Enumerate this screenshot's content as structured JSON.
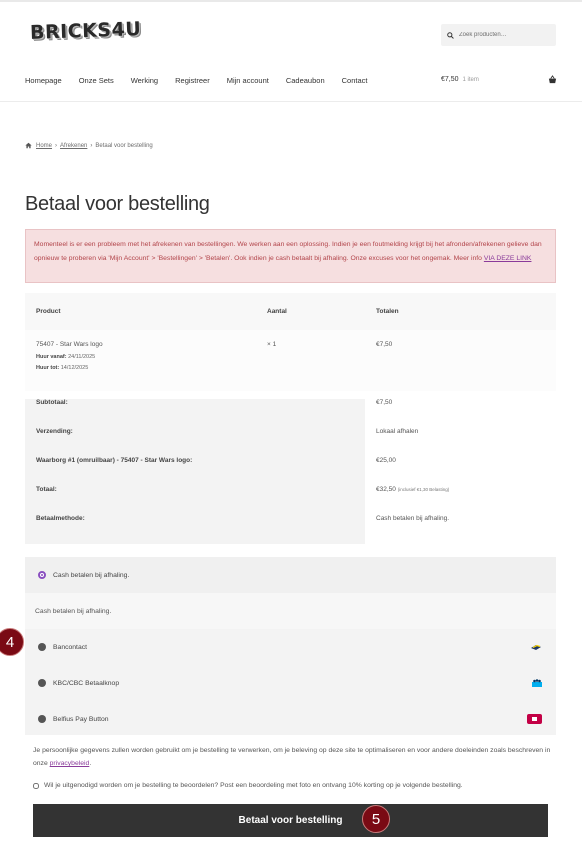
{
  "header": {
    "logo_text": "BRICKS4U",
    "search_placeholder": "Zoek producten…",
    "nav": [
      "Homepage",
      "Onze Sets",
      "Werking",
      "Registreer",
      "Mijn account",
      "Cadeaubon",
      "Contact"
    ],
    "cart_amount": "€7,50",
    "cart_count": "1 item",
    "icons": {
      "search": "search-icon",
      "cart": "basket-icon",
      "home": "home-icon"
    }
  },
  "breadcrumb": {
    "home": "Home",
    "checkout": "Afrekenen",
    "current": "Betaal voor bestelling",
    "separator": "›"
  },
  "page_title": "Betaal voor bestelling",
  "notice": {
    "text": "Momenteel is er een probleem met het afrekenen van bestellingen. We werken aan een oplossing. Indien je een foutmelding krijgt bij het afronden/afrekenen gelieve dan opnieuw te proberen via 'Mijn Account'  > 'Bestellingen'  > 'Betalen'. Ook indien je cash betaalt bij afhaling. Onze excuses voor het ongemak. Meer info",
    "link": "VIA DEZE LINK",
    "colors": {
      "background": "#f6dfe0",
      "text": "#b2444a"
    }
  },
  "order_table": {
    "headers": {
      "product": "Product",
      "quantity": "Aantal",
      "totals": "Totalen"
    },
    "item": {
      "name": "75407 - Star Wars logo",
      "rent_from_label": "Huur vanaf:",
      "rent_from": "24/11/2025",
      "rent_to_label": "Huur tot:",
      "rent_to": "14/12/2025",
      "quantity": "× 1",
      "total": "€7,50"
    },
    "totals": [
      {
        "label": "Subtotaal:",
        "value": "€7,50"
      },
      {
        "label": "Verzending:",
        "value": "Lokaal afhalen"
      },
      {
        "label": "Waarborg #1 (omruilbaar) - 75407 - Star Wars logo:",
        "value": "€25,00"
      },
      {
        "label": "Totaal:",
        "value": "€32,50",
        "note": "(inclusief €1,30 Belasting)"
      },
      {
        "label": "Betaalmethode:",
        "value": "Cash betalen bij afhaling."
      }
    ]
  },
  "payment": {
    "selected": "Cash betalen bij afhaling.",
    "selected_description": "Cash betalen bij afhaling.",
    "options": [
      {
        "label": "Bancontact",
        "icon": "bancontact-icon"
      },
      {
        "label": "KBC/CBC Betaalknop",
        "icon": "kbc-icon"
      },
      {
        "label": "Belfius Pay Button",
        "icon": "belfius-icon"
      }
    ],
    "accent_color": "#8a4fc0"
  },
  "privacy": {
    "text": "Je persoonlijke gegevens zullen worden gebruikt om je bestelling te verwerken, om je beleving op deze site te optimaliseren en voor andere doeleinden zoals beschreven in onze",
    "link": "privacybeleid",
    "end": "."
  },
  "review_optin": "Wil je uitgenodigd worden om je bestelling te beoordelen? Post een beoordeling met foto en ontvang 10% korting op je volgende bestelling.",
  "submit_label": "Betaal voor bestelling",
  "badges": {
    "first": "4",
    "second": "5"
  }
}
